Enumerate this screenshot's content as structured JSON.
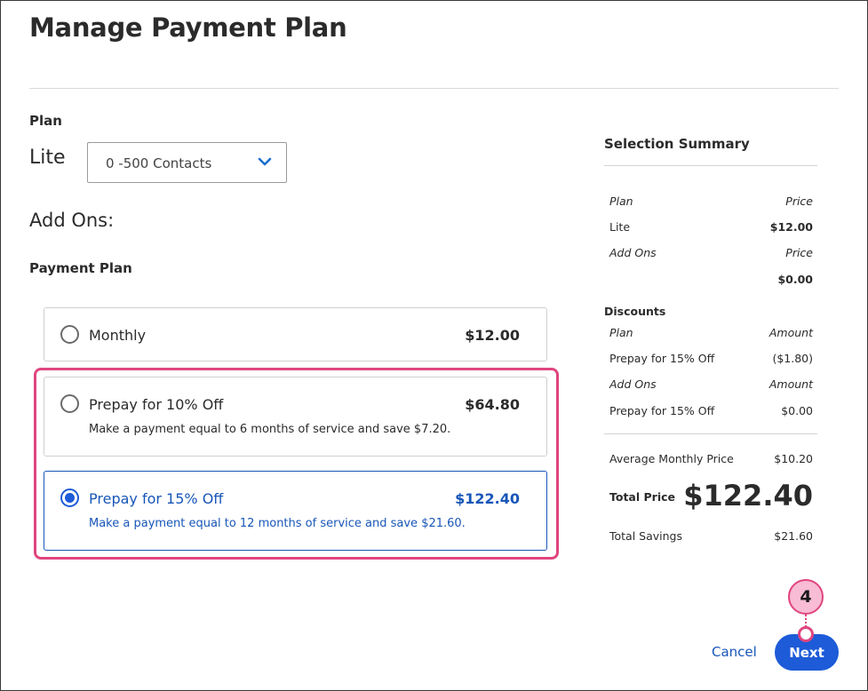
{
  "title": "Manage Payment Plan",
  "plan_section": {
    "label": "Plan",
    "plan_name": "Lite",
    "contacts_select": {
      "value": "0 -500 Contacts"
    },
    "addons_label": "Add Ons:"
  },
  "payment_plan": {
    "label": "Payment Plan",
    "options": [
      {
        "label": "Monthly",
        "price": "$12.00",
        "description": "",
        "selected": false
      },
      {
        "label": "Prepay for 10% Off",
        "price": "$64.80",
        "description": "Make a payment equal to 6 months of service and save $7.20.",
        "selected": false
      },
      {
        "label": "Prepay for 15% Off",
        "price": "$122.40",
        "description": "Make a payment equal to 12 months of service and save $21.60.",
        "selected": true
      }
    ]
  },
  "summary": {
    "title": "Selection Summary",
    "plan_header": "Plan",
    "price_header": "Price",
    "plan_name": "Lite",
    "plan_price": "$12.00",
    "addons_header": "Add Ons",
    "addons_price_header": "Price",
    "addons_total": "$0.00",
    "discounts_header": "Discounts",
    "disc_plan_header": "Plan",
    "disc_amount_header": "Amount",
    "disc_plan_item": "Prepay for 15% Off",
    "disc_plan_amount": "($1.80)",
    "disc_addons_header": "Add Ons",
    "disc_addons_amount_header": "Amount",
    "disc_addons_item": "Prepay for 15% Off",
    "disc_addons_amount": "$0.00",
    "avg_monthly_label": "Average Monthly Price",
    "avg_monthly_value": "$10.20",
    "total_label": "Total Price",
    "total_value": "$122.40",
    "savings_label": "Total Savings",
    "savings_value": "$21.60"
  },
  "actions": {
    "cancel": "Cancel",
    "next": "Next"
  },
  "callout": {
    "number": "4"
  },
  "colors": {
    "accent": "#1d5bd8",
    "link": "#1856b8",
    "highlight": "#e0457f",
    "callout_fill": "#f8bcd4"
  },
  "icons": {
    "select": "chevron-down-icon"
  }
}
